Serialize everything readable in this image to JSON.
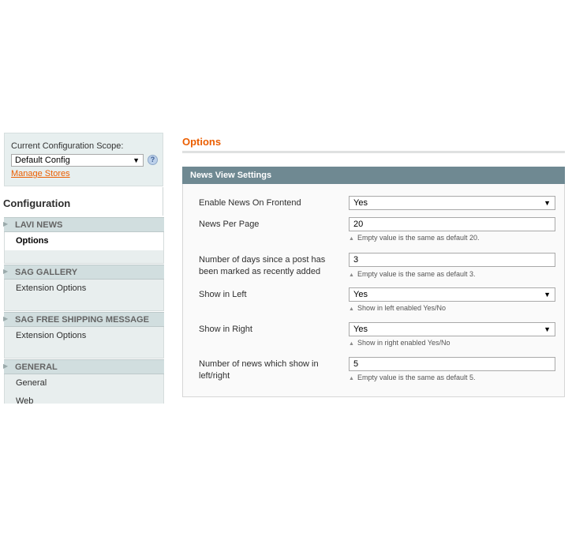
{
  "scope": {
    "label": "Current Configuration Scope:",
    "selected": "Default Config",
    "help_icon": "help-icon",
    "manage_link": "Manage Stores"
  },
  "sidebar": {
    "title": "Configuration",
    "sections": [
      {
        "label": "LAVI NEWS",
        "items": [
          {
            "label": "Options",
            "active": true
          }
        ]
      },
      {
        "label": "SAG GALLERY",
        "items": [
          {
            "label": "Extension Options",
            "active": false
          }
        ]
      },
      {
        "label": "SAG FREE SHIPPING MESSAGE",
        "items": [
          {
            "label": "Extension Options",
            "active": false
          }
        ]
      },
      {
        "label": "GENERAL",
        "items": [
          {
            "label": "General",
            "active": false
          },
          {
            "label": "Web",
            "active": false
          }
        ]
      }
    ]
  },
  "main": {
    "title": "Options",
    "fieldset_title": "News View Settings",
    "fields": [
      {
        "label": "Enable News On Frontend",
        "type": "select",
        "value": "Yes",
        "note": ""
      },
      {
        "label": "News Per Page",
        "type": "text",
        "value": "20",
        "note": "Empty value is the same as default 20."
      },
      {
        "label": "Number of days since a post has been marked as recently added",
        "type": "text",
        "value": "3",
        "note": "Empty value is the same as default 3."
      },
      {
        "label": "Show in Left",
        "type": "select",
        "value": "Yes",
        "note": "Show in left enabled Yes/No"
      },
      {
        "label": "Show in Right",
        "type": "select",
        "value": "Yes",
        "note": "Show in right enabled Yes/No"
      },
      {
        "label": "Number of news which show in left/right",
        "type": "text",
        "value": "5",
        "note": "Empty value is the same as default 5."
      }
    ]
  },
  "colors": {
    "accent": "#eb5e00",
    "fieldset_header": "#6f8992",
    "nav_header": "#d1dedf",
    "nav_item": "#e8eeee"
  }
}
